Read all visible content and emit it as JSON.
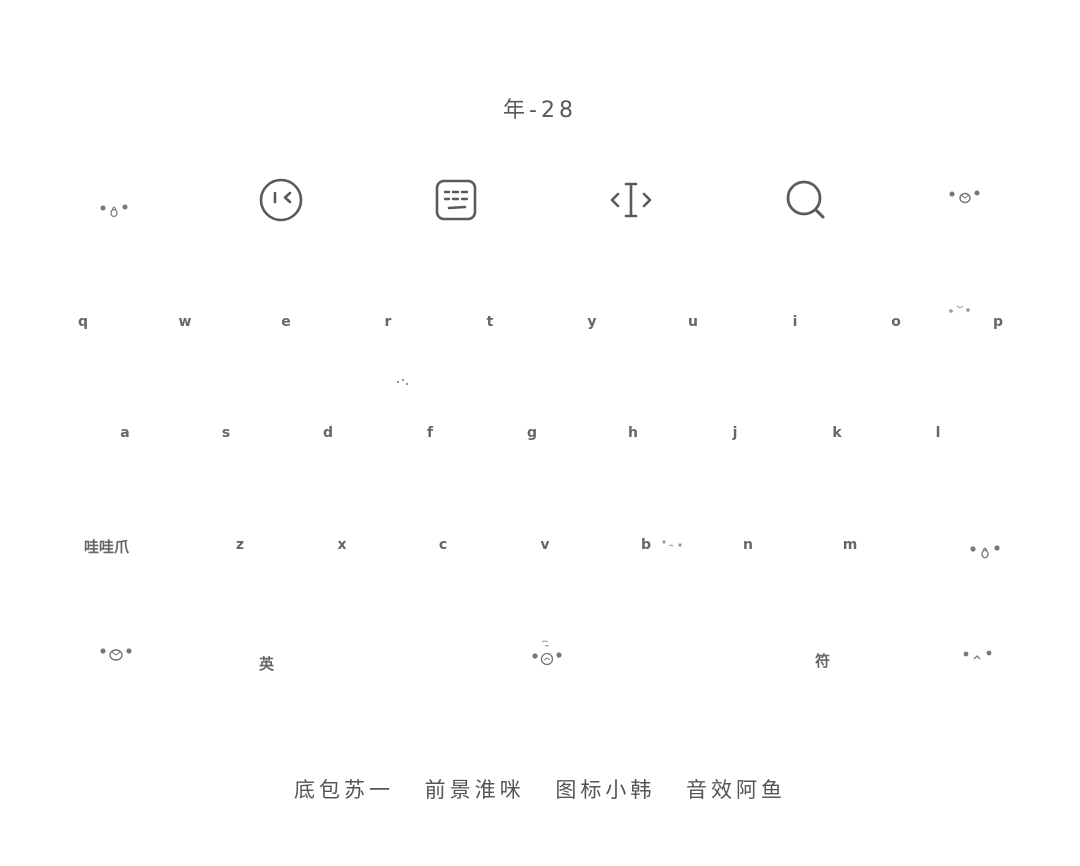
{
  "title": "年-28",
  "toolbar": {
    "icons": [
      "kaomoji-face-icon",
      "emoji-wink-icon",
      "keyboard-icon",
      "cursor-edit-icon",
      "search-icon",
      "kaomoji-face-icon"
    ]
  },
  "keyboard": {
    "row1": [
      "q",
      "w",
      "e",
      "r",
      "t",
      "y",
      "u",
      "i",
      "o",
      "p"
    ],
    "row2": [
      "a",
      "s",
      "d",
      "f",
      "g",
      "h",
      "j",
      "k",
      "l"
    ],
    "row3": [
      "z",
      "x",
      "c",
      "v",
      "b",
      "n",
      "m"
    ],
    "shift_label": "哇哇爪",
    "lang_label": "英",
    "symbol_label": "符"
  },
  "credits": [
    "底包苏一",
    "前景淮咪",
    "图标小韩",
    "音效阿鱼"
  ],
  "colors": {
    "background": "#ffffff",
    "text": "#666666",
    "icon_stroke": "#5a5a5a"
  }
}
